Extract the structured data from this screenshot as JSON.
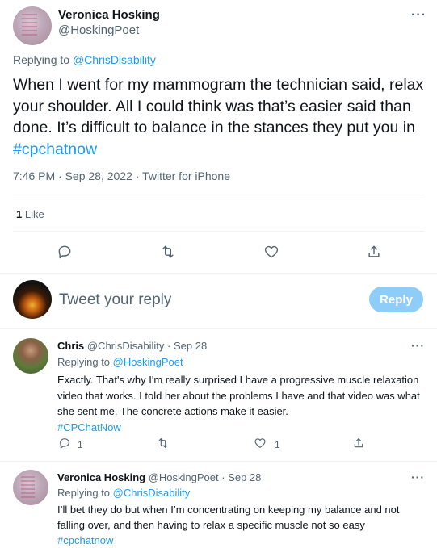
{
  "main_tweet": {
    "author_name": "Veronica Hosking",
    "author_handle": "@HoskingPoet",
    "replying_prefix": "Replying to",
    "replying_to": "@ChrisDisability",
    "text": "When I went for my mammogram the technician said, relax your shoulder. All I could think was that’s easier said than done. It’s difficult to balance in the stances they put you in",
    "hashtag": "#cpchatnow",
    "timestamp": "7:46 PM · Sep 28, 2022 · Twitter for iPhone",
    "likes_count": "1",
    "likes_label": "Like",
    "more_glyph": "···"
  },
  "composer": {
    "placeholder": "Tweet your reply",
    "button_label": "Reply"
  },
  "replies": [
    {
      "author_name": "Chris",
      "author_handle": "@ChrisDisability",
      "date": "· Sep 28",
      "replying_prefix": "Replying to",
      "replying_to": "@HoskingPoet",
      "text": "Exactly. That's why I'm really surprised I have a progressive muscle relaxation video that works. I told her about the problems I have and that video was what she sent me. The concrete actions make it easier.",
      "hashtag": "#CPChatNow",
      "reply_count": "1",
      "like_count": "1",
      "more_glyph": "···"
    },
    {
      "author_name": "Veronica Hosking",
      "author_handle": "@HoskingPoet",
      "date": "· Sep 28",
      "replying_prefix": "Replying to",
      "replying_to": "@ChrisDisability",
      "text": "I’ll bet they do but when I’m concentrating on keeping my balance and not falling over, and then having to relax a specific muscle not so easy",
      "hashtag": "#cpchatnow",
      "more_glyph": "···"
    }
  ],
  "colors": {
    "accent": "#1d9bf0",
    "muted": "#536471",
    "reply_button_disabled": "#8ecdf8",
    "divider": "#eff3f4"
  },
  "icons": [
    "reply-icon",
    "retweet-icon",
    "like-icon",
    "share-icon",
    "more-icon"
  ]
}
